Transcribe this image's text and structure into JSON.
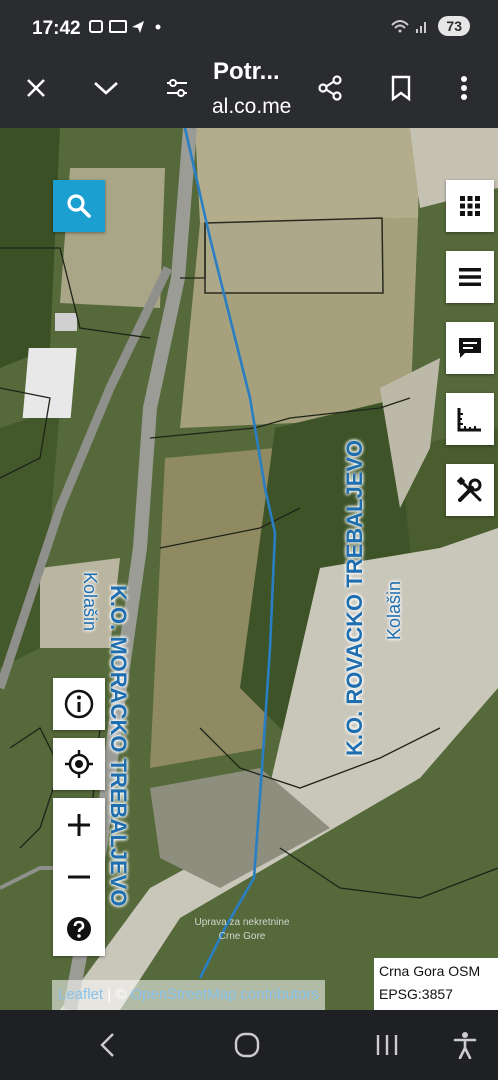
{
  "status": {
    "time": "17:42",
    "battery": "73"
  },
  "tab": {
    "title": "Potr...",
    "url": "al.co.me"
  },
  "map": {
    "labels": {
      "ko_moracko": "K.O. MORACKO TREBALJEVO",
      "kolasin_left": "Kolašin",
      "ko_rovacko": "K.O. ROVACKO TREBALJEVO",
      "kolasin_right": "Kolašin",
      "watermark_line1": "Uprava za nekretnine",
      "watermark_line2": "Crne Gore"
    },
    "attribution": {
      "leaflet": "Leaflet",
      "separator": " | © ",
      "osm": "OpenStreetMap contributors"
    },
    "crs": {
      "line1": "Crna Gora OSM",
      "line2": "EPSG:3857"
    }
  },
  "colors": {
    "accent": "#1a9fd0",
    "label": "#1f6fb0",
    "boundary": "#2a7fc4"
  }
}
